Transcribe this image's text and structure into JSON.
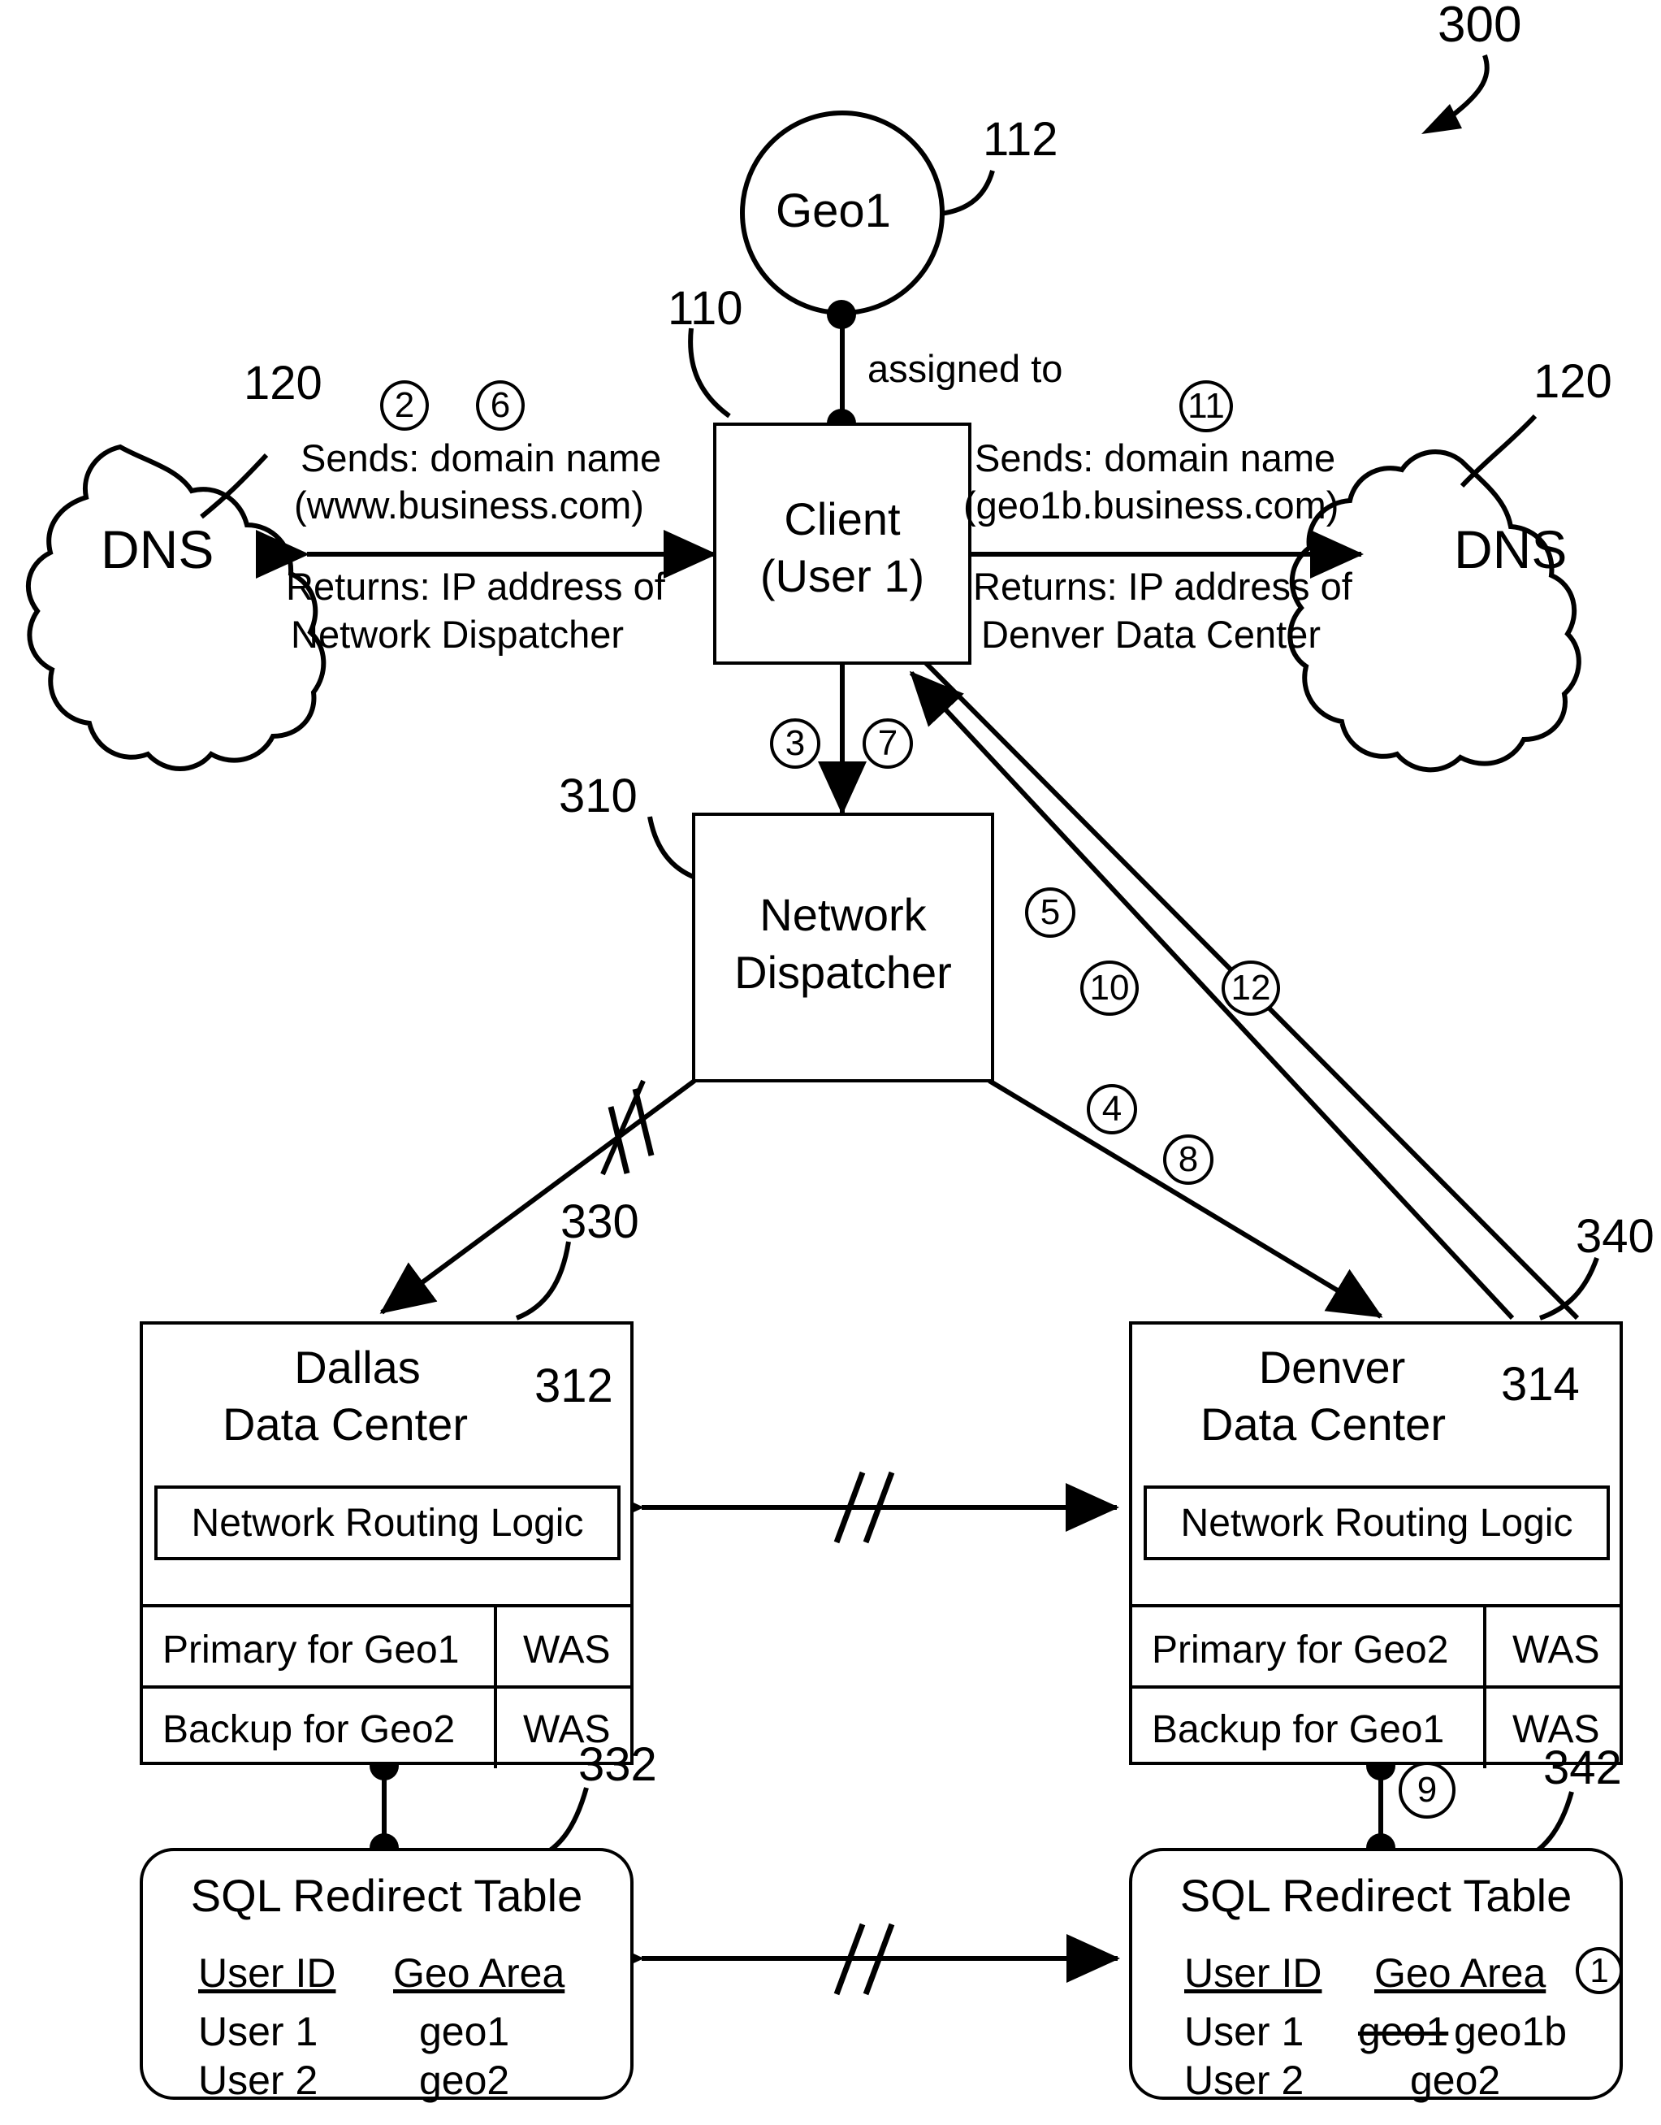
{
  "figure": {
    "number": "300"
  },
  "nodes": {
    "geo1": {
      "label": "Geo1",
      "ref": "112"
    },
    "client": {
      "line1": "Client",
      "line2": "(User 1)",
      "ref": "110"
    },
    "dns_left": {
      "label": "DNS",
      "ref": "120"
    },
    "dns_right": {
      "label": "DNS",
      "ref": "120"
    },
    "dispatcher": {
      "line1": "Network",
      "line2": "Dispatcher",
      "ref": "310"
    },
    "dallas": {
      "title_line1": "Dallas",
      "title_line2": "Data Center",
      "ref_inner": "312",
      "ref_outer": "330",
      "routing_logic": "Network Routing Logic",
      "rows": [
        {
          "role": "Primary for Geo1",
          "server": "WAS"
        },
        {
          "role": "Backup for Geo2",
          "server": "WAS"
        }
      ]
    },
    "denver": {
      "title_line1": "Denver",
      "title_line2": "Data Center",
      "ref_inner": "314",
      "ref_outer": "340",
      "routing_logic": "Network Routing Logic",
      "rows": [
        {
          "role": "Primary for Geo2",
          "server": "WAS"
        },
        {
          "role": "Backup for Geo1",
          "server": "WAS"
        }
      ]
    },
    "sql_left": {
      "title": "SQL Redirect Table",
      "ref": "332",
      "col_user": "User ID",
      "col_geo": "Geo Area",
      "rows": [
        {
          "user": "User 1",
          "geo": "geo1",
          "geo_old": "",
          "step": ""
        },
        {
          "user": "User 2",
          "geo": "geo2",
          "geo_old": "",
          "step": ""
        }
      ]
    },
    "sql_right": {
      "title": "SQL Redirect Table",
      "ref": "342",
      "col_user": "User ID",
      "col_geo": "Geo Area",
      "header_step": "1",
      "rows": [
        {
          "user": "User 1",
          "geo_old": "geo1",
          "geo": "geo1b"
        },
        {
          "user": "User 2",
          "geo_old": "",
          "geo": "geo2"
        }
      ]
    }
  },
  "edges": {
    "assigned_to": "assigned to",
    "dns_left": {
      "steps": [
        "2",
        "6"
      ],
      "sends_line1": "Sends: domain name",
      "sends_line2": "(www.business.com)",
      "returns_line1": "Returns: IP address of",
      "returns_line2": "Network Dispatcher"
    },
    "dns_right": {
      "steps": [
        "11"
      ],
      "sends_line1": "Sends: domain name",
      "sends_line2": "(geo1b.business.com)",
      "returns_line1": "Returns: IP address of",
      "returns_line2": "Denver Data Center"
    },
    "client_to_dispatcher_steps": [
      "3",
      "7"
    ],
    "denver_to_client_steps": [
      "5",
      "10",
      "12"
    ],
    "dispatcher_to_denver_steps": [
      "4",
      "8"
    ],
    "denver_table_step": "9"
  },
  "colors": {
    "stroke": "#000000",
    "background": "#ffffff"
  }
}
